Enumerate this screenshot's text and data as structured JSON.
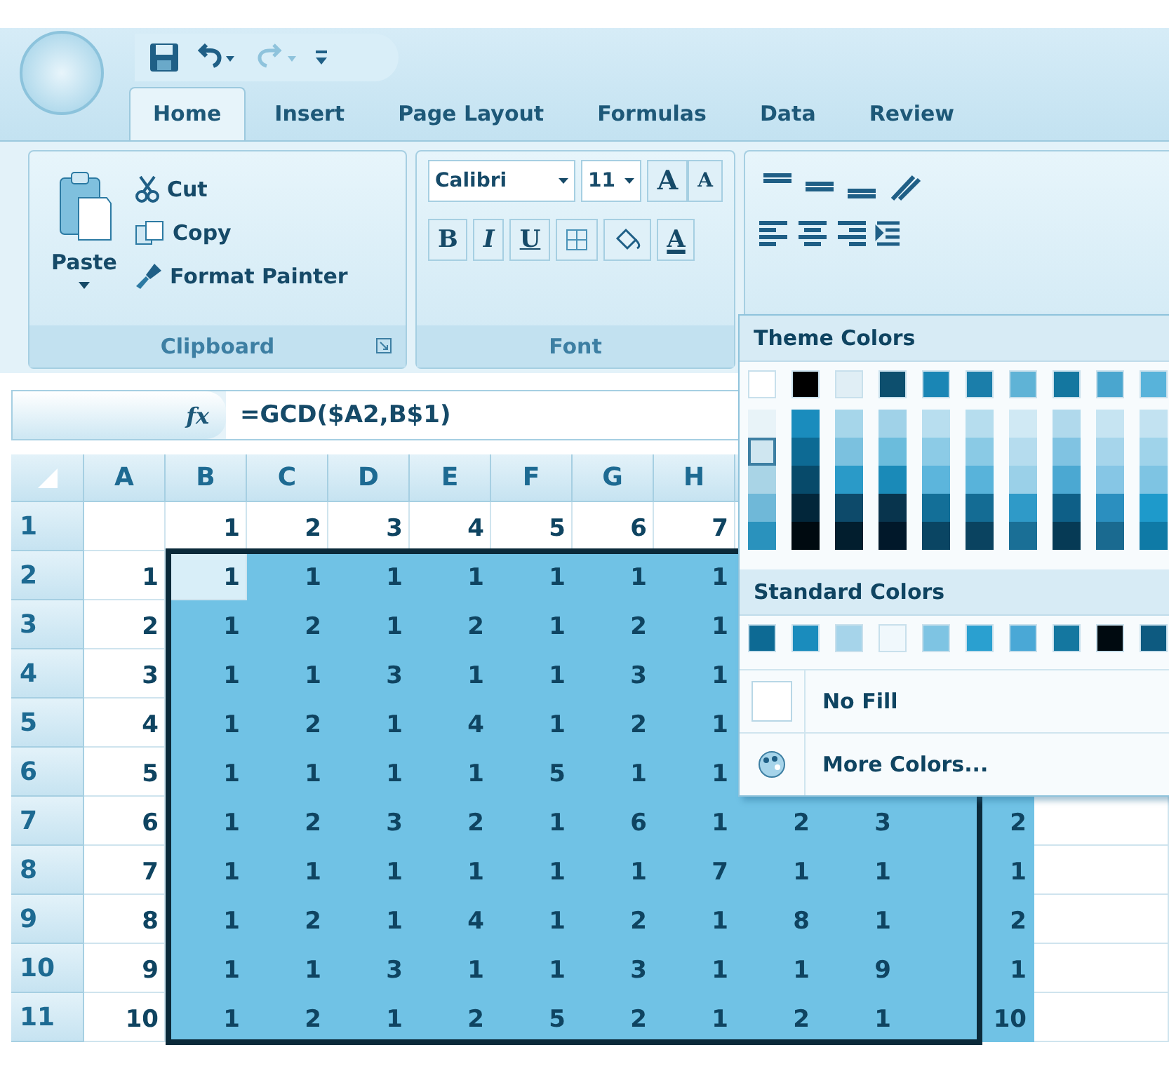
{
  "quick_access": {
    "redo_enabled": false
  },
  "tabs": [
    {
      "label": "Home",
      "selected": true
    },
    {
      "label": "Insert",
      "selected": false
    },
    {
      "label": "Page Layout",
      "selected": false
    },
    {
      "label": "Formulas",
      "selected": false
    },
    {
      "label": "Data",
      "selected": false
    },
    {
      "label": "Review",
      "selected": false
    }
  ],
  "clipboard": {
    "paste": "Paste",
    "cut": "Cut",
    "copy": "Copy",
    "format_painter": "Format Painter",
    "label": "Clipboard"
  },
  "font": {
    "name": "Calibri",
    "size": "11",
    "grow": "A",
    "shrink": "A",
    "bold": "B",
    "italic": "I",
    "underline": "U",
    "font_color": "A",
    "label": "Font"
  },
  "formula_bar": {
    "fx": "fx",
    "formula": "=GCD($A2,B$1)"
  },
  "sheet": {
    "columns": [
      "A",
      "B",
      "C",
      "D",
      "E",
      "F",
      "G",
      "H"
    ],
    "rows": [
      {
        "header": "1",
        "values": [
          "1",
          "2",
          "3",
          "4",
          "5",
          "6",
          "7"
        ],
        "in_selection": false,
        "first_value_active": false
      },
      {
        "header": "2",
        "a": "1",
        "values": [
          "1",
          "1",
          "1",
          "1",
          "1",
          "1",
          "1"
        ],
        "in_selection": true,
        "first_value_active": true
      },
      {
        "header": "3",
        "a": "2",
        "values": [
          "1",
          "2",
          "1",
          "2",
          "1",
          "2",
          "1"
        ],
        "in_selection": true,
        "first_value_active": false
      },
      {
        "header": "4",
        "a": "3",
        "values": [
          "1",
          "1",
          "3",
          "1",
          "1",
          "3",
          "1"
        ],
        "in_selection": true,
        "first_value_active": false
      },
      {
        "header": "5",
        "a": "4",
        "values": [
          "1",
          "2",
          "1",
          "4",
          "1",
          "2",
          "1"
        ],
        "in_selection": true,
        "first_value_active": false
      },
      {
        "header": "6",
        "a": "5",
        "values": [
          "1",
          "1",
          "1",
          "1",
          "5",
          "1",
          "1"
        ],
        "in_selection": true,
        "first_value_active": false
      },
      {
        "header": "7",
        "a": "6",
        "values": [
          "1",
          "2",
          "3",
          "2",
          "1",
          "6",
          "1",
          "2",
          "3",
          "2"
        ],
        "in_selection": true,
        "first_value_active": false
      },
      {
        "header": "8",
        "a": "7",
        "values": [
          "1",
          "1",
          "1",
          "1",
          "1",
          "1",
          "7",
          "1",
          "1",
          "1"
        ],
        "in_selection": true,
        "first_value_active": false
      },
      {
        "header": "9",
        "a": "8",
        "values": [
          "1",
          "2",
          "1",
          "4",
          "1",
          "2",
          "1",
          "8",
          "1",
          "2"
        ],
        "in_selection": true,
        "first_value_active": false
      },
      {
        "header": "10",
        "a": "9",
        "values": [
          "1",
          "1",
          "3",
          "1",
          "1",
          "3",
          "1",
          "1",
          "9",
          "1"
        ],
        "in_selection": true,
        "first_value_active": false
      },
      {
        "header": "11",
        "a": "10",
        "values": [
          "1",
          "2",
          "1",
          "2",
          "5",
          "2",
          "1",
          "2",
          "1",
          "10"
        ],
        "in_selection": true,
        "first_value_active": false
      }
    ]
  },
  "color_menu": {
    "theme_title": "Theme Colors",
    "theme_colors": [
      {
        "color": "#ffffff",
        "shades": [
          {
            "color": "#e8f3f8",
            "selected": false
          },
          {
            "color": "#cfe6f0",
            "selected": true
          },
          {
            "color": "#a9d4e6",
            "selected": false
          },
          {
            "color": "#6fb8d8",
            "selected": false
          },
          {
            "color": "#2a92bd",
            "selected": false
          }
        ]
      },
      {
        "color": "#000000",
        "shades": [
          {
            "color": "#1a8cbd",
            "selected": false
          },
          {
            "color": "#0d6a94",
            "selected": false
          },
          {
            "color": "#074a6a",
            "selected": false
          },
          {
            "color": "#02263a",
            "selected": false
          },
          {
            "color": "#000a10",
            "selected": false
          }
        ]
      },
      {
        "color": "#e0eef5",
        "shades": [
          {
            "color": "#a6d6ea",
            "selected": false
          },
          {
            "color": "#7bc1df",
            "selected": false
          },
          {
            "color": "#2a9ac8",
            "selected": false
          },
          {
            "color": "#0d4a6a",
            "selected": false
          },
          {
            "color": "#021e2e",
            "selected": false
          }
        ]
      },
      {
        "color": "#0d4f6e",
        "shades": [
          {
            "color": "#a0d2e8",
            "selected": false
          },
          {
            "color": "#6bbcdc",
            "selected": false
          },
          {
            "color": "#1a8ab8",
            "selected": false
          },
          {
            "color": "#08344d",
            "selected": false
          },
          {
            "color": "#01182a",
            "selected": false
          }
        ]
      },
      {
        "color": "#1a86b5",
        "shades": [
          {
            "color": "#b8deef",
            "selected": false
          },
          {
            "color": "#8ccbe6",
            "selected": false
          },
          {
            "color": "#5cb5dc",
            "selected": false
          },
          {
            "color": "#136f98",
            "selected": false
          },
          {
            "color": "#0a4563",
            "selected": false
          }
        ]
      },
      {
        "color": "#1b7eaa",
        "shades": [
          {
            "color": "#b6ddee",
            "selected": false
          },
          {
            "color": "#8acae5",
            "selected": false
          },
          {
            "color": "#58b3da",
            "selected": false
          },
          {
            "color": "#146c94",
            "selected": false
          },
          {
            "color": "#0a4360",
            "selected": false
          }
        ]
      },
      {
        "color": "#5fb3d6",
        "shades": [
          {
            "color": "#d0e9f4",
            "selected": false
          },
          {
            "color": "#b5dcee",
            "selected": false
          },
          {
            "color": "#9ad0e8",
            "selected": false
          },
          {
            "color": "#2f9ac8",
            "selected": false
          },
          {
            "color": "#1a6f96",
            "selected": false
          }
        ]
      },
      {
        "color": "#1477a0",
        "shades": [
          {
            "color": "#b0d9ec",
            "selected": false
          },
          {
            "color": "#80c3e2",
            "selected": false
          },
          {
            "color": "#4ba8d2",
            "selected": false
          },
          {
            "color": "#0e5f87",
            "selected": false
          },
          {
            "color": "#063a55",
            "selected": false
          }
        ]
      },
      {
        "color": "#4aa6cf",
        "shades": [
          {
            "color": "#c6e4f2",
            "selected": false
          },
          {
            "color": "#a6d5eb",
            "selected": false
          },
          {
            "color": "#86c6e5",
            "selected": false
          },
          {
            "color": "#2b8fbf",
            "selected": false
          },
          {
            "color": "#1a6a90",
            "selected": false
          }
        ]
      },
      {
        "color": "#58b3da",
        "shades": [
          {
            "color": "#c2e2f1",
            "selected": false
          },
          {
            "color": "#9fd3ea",
            "selected": false
          },
          {
            "color": "#7ec4e3",
            "selected": false
          },
          {
            "color": "#1e9acb",
            "selected": false
          },
          {
            "color": "#0f7aa6",
            "selected": false
          }
        ]
      }
    ],
    "standard_title": "Standard Colors",
    "standard_colors": [
      {
        "color": "#0d6a94"
      },
      {
        "color": "#1a8cbd"
      },
      {
        "color": "#a6d4ea"
      },
      {
        "color": "#f0f8fc"
      },
      {
        "color": "#7ec4e3"
      },
      {
        "color": "#2aa0d0"
      },
      {
        "color": "#4aa8d6"
      },
      {
        "color": "#1477a0"
      },
      {
        "color": "#000a10"
      },
      {
        "color": "#0d5a80"
      }
    ],
    "no_fill": "No Fill",
    "more_colors": "More Colors..."
  }
}
